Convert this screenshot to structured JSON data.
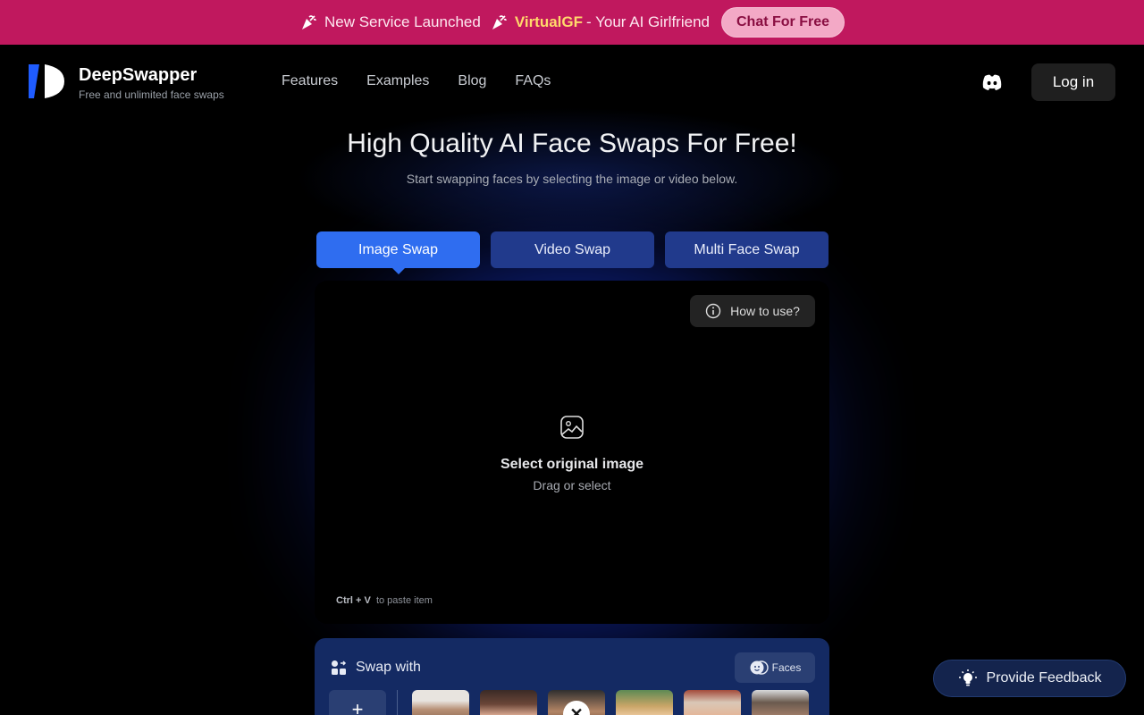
{
  "banner": {
    "announcement": "New Service Launched",
    "brand": "VirtualGF",
    "tagline": "- Your AI Girlfriend",
    "cta": "Chat For Free",
    "icon": "party-popper-icon",
    "background": "#c0185e"
  },
  "header": {
    "brand": "DeepSwapper",
    "tagline": "Free and unlimited face swaps",
    "nav": [
      {
        "label": "Features"
      },
      {
        "label": "Examples"
      },
      {
        "label": "Blog"
      },
      {
        "label": "FAQs"
      }
    ],
    "discord_icon": "discord-icon",
    "login": "Log in"
  },
  "hero": {
    "title": "High Quality AI Face Swaps For Free!",
    "subtitle": "Start swapping faces by selecting the image or video below."
  },
  "tabs": [
    {
      "label": "Image Swap",
      "active": true
    },
    {
      "label": "Video Swap",
      "active": false
    },
    {
      "label": "Multi Face Swap",
      "active": false
    }
  ],
  "dropzone": {
    "how_to": "How to use?",
    "title": "Select original image",
    "hint": "Drag or select",
    "paste_keys": "Ctrl + V",
    "paste_text": "to paste item"
  },
  "swap": {
    "title": "Swap with",
    "faces_button": "Faces",
    "add_label": "+",
    "remove_label": "✕"
  },
  "feedback": {
    "label": "Provide Feedback"
  },
  "colors": {
    "accent": "#2f6df0",
    "tab_inactive": "#213a8c",
    "glow": "#2850ff"
  }
}
